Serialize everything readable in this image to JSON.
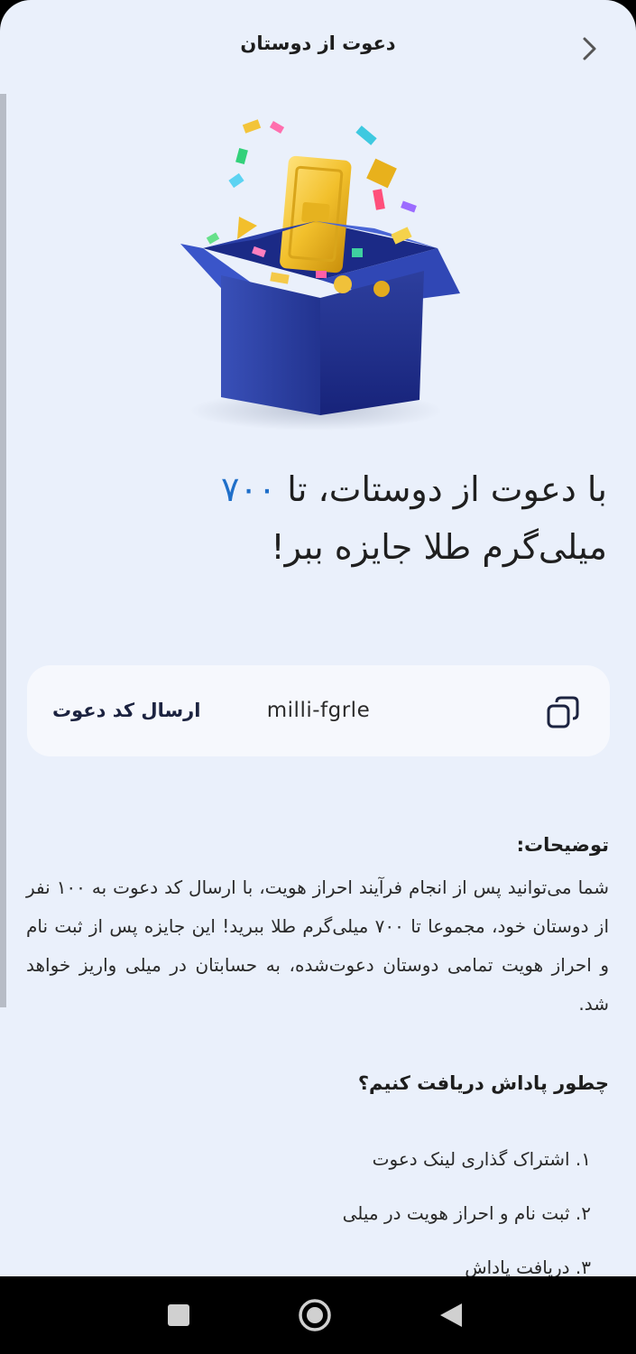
{
  "header": {
    "title": "دعوت از دوستان",
    "back_icon": "chevron-right-icon"
  },
  "hero": {
    "illustration": "gift-box-with-gold-bar"
  },
  "headline": {
    "part1": "با دعوت از دوستات، تا ",
    "amount": "۷۰۰",
    "part2": "میلی‌گرم طلا جایزه ببر!",
    "accent_color": "#1f6fc9"
  },
  "invite": {
    "send_label": "ارسال کد دعوت",
    "code": "milli-fgrle",
    "copy_icon": "copy-icon"
  },
  "description": {
    "title": "توضیحات:",
    "body": "شما می‌توانید پس از انجام فرآیند احراز هویت، با ارسال کد دعوت به ۱۰۰ نفر از دوستان خود، مجموعا تا ۷۰۰ میلی‌گرم طلا ببرید! این جایزه پس از ثبت نام و احراز هویت تمامی دوستان دعوت‌شده، به حسابتان در میلی واریز خواهد شد."
  },
  "how": {
    "title": "چطور پاداش دریافت کنیم؟",
    "steps": [
      "۱. اشتراک گذاری لینک دعوت",
      "۲. ثبت نام و احراز هویت در میلی",
      "۳. دریافت پاداش"
    ]
  },
  "navbar": {
    "recents_icon": "square-icon",
    "home_icon": "home-circle-icon",
    "back_icon": "triangle-back-icon"
  }
}
